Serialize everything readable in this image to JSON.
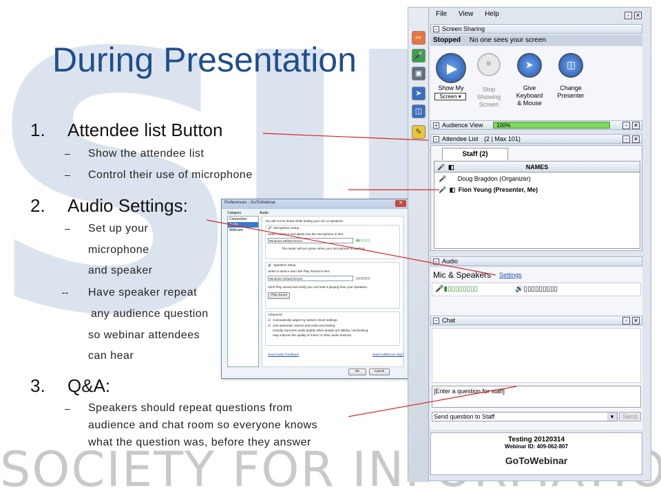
{
  "slide": {
    "watermark": "SID",
    "footer": "SOCIETY FOR INFORMATION DISPLAY",
    "title": "During Presentation",
    "items": [
      {
        "num": "1.",
        "heading": "Attendee list Button"
      },
      {
        "num": "2.",
        "heading": "Audio Settings:"
      },
      {
        "num": "3.",
        "heading": "Q&A:"
      }
    ],
    "item1_subs": [
      "Show the attendee list",
      "Control their use of microphone"
    ],
    "item2_subs": [
      "Set up your",
      "microphone",
      "and speaker",
      "Have speaker repeat",
      "any audience question",
      "so webinar attendees",
      "can hear"
    ],
    "item2_dash_alt": "--",
    "item3_sub": [
      "Speakers should repeat questions from",
      "audience and chat room so everyone knows",
      "what the question was, before they answer"
    ],
    "dash": "–"
  },
  "preferences": {
    "title": "Preferences - GoToWebinar",
    "close": "✕",
    "category_label": "Category",
    "audio_label": "Audio",
    "categories": [
      "Connection",
      "Audio",
      "Webcam"
    ],
    "note": "You will not be heard while testing your mic or speakers.",
    "mic_setup": "Microphone Setup",
    "mic_instruction": "Select a device and speak into the microphone to test:",
    "mic_device": "Windows Default Device",
    "mic_hint": "The meter will turn green when your microphone is working.",
    "speakers_setup": "Speakers Setup",
    "speakers_instruction": "Select a device and click Play Sound to test:",
    "speakers_device": "Windows Default Device",
    "speakers_hint": "Click Play Sound and verify you can hear it playing from your speakers.",
    "play_sound": "Play Sound",
    "advanced": "Advanced",
    "adv_opt1": "Automatically adjust my system mixer settings",
    "adv_opt2": "Use automatic volume and noise processing",
    "adv_note1": "Usually improves audio quality when people are talking. Unchecking",
    "adv_note2": "may improve the quality of music or other audio sources.",
    "send_feedback": "Send Audio Feedback",
    "need_help": "Need Additional Help?",
    "ok": "OK",
    "cancel": "Cancel"
  },
  "gtw": {
    "menu": [
      "File",
      "View",
      "Help"
    ],
    "screen_sharing": "Screen Sharing",
    "stopped": "Stopped",
    "no_one": "No one sees your screen",
    "show_my": "Show My",
    "screen_dropdown": "Screen ▾",
    "stop_showing": [
      "Stop",
      "Showing",
      "Screen"
    ],
    "give_keyboard": [
      "Give",
      "Keyboard",
      "& Mouse"
    ],
    "change_presenter": [
      "Change",
      "Presenter"
    ],
    "audience_view": "Audience View",
    "audience_pct": "100%",
    "attendee_list": "Attendee List",
    "attendee_count": "(2 | Max 101)",
    "staff_tab": "Staff (2)",
    "names_header": "NAMES",
    "attendees": [
      "Doug Bragdon (Organizer)",
      "Fion Yeung (Presenter, Me)"
    ],
    "audio": "Audio",
    "mic_speakers": "Mic & Speakers",
    "settings": "Settings",
    "chat": "Chat",
    "question_placeholder": "[Enter a question for staff]",
    "send_to": "Send question to Staff",
    "send": "Send",
    "webinar_title": "Testing 20120314",
    "webinar_id": "Webinar ID: 409-062-807",
    "brand": "GoToWebinar"
  }
}
